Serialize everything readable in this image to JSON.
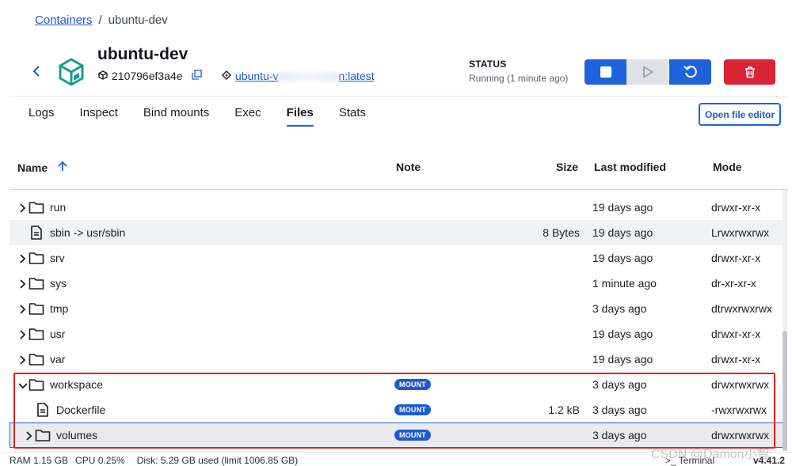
{
  "breadcrumb": {
    "root": "Containers",
    "separator": "/",
    "current": "ubuntu-dev"
  },
  "container": {
    "name": "ubuntu-dev",
    "id": "210796ef3a4e",
    "image_prefix": "ubuntu-v",
    "image_suffix": "n:latest"
  },
  "status": {
    "label": "STATUS",
    "value": "Running (1 minute ago)"
  },
  "colors": {
    "accent": "#1e63db",
    "danger": "#d92535",
    "container_icon": "#1b9b8a",
    "highlight": "#e02020"
  },
  "tabs": [
    {
      "label": "Logs"
    },
    {
      "label": "Inspect"
    },
    {
      "label": "Bind mounts"
    },
    {
      "label": "Exec"
    },
    {
      "label": "Files",
      "active": true
    },
    {
      "label": "Stats"
    }
  ],
  "open_editor": "Open file editor",
  "table": {
    "headers": {
      "name": "Name",
      "note": "Note",
      "size": "Size",
      "modified": "Last modified",
      "mode": "Mode"
    },
    "sort_icon": "arrow-up-icon",
    "rows": [
      {
        "type": "folder",
        "name": "run",
        "note": "",
        "size": "",
        "modified": "19 days ago",
        "mode": "drwxr-xr-x"
      },
      {
        "type": "file",
        "name": "sbin -> usr/sbin",
        "note": "",
        "size": "8 Bytes",
        "modified": "19 days ago",
        "mode": "Lrwxrwxrwx"
      },
      {
        "type": "folder",
        "name": "srv",
        "note": "",
        "size": "",
        "modified": "19 days ago",
        "mode": "drwxr-xr-x"
      },
      {
        "type": "folder",
        "name": "sys",
        "note": "",
        "size": "",
        "modified": "1 minute ago",
        "mode": "dr-xr-xr-x"
      },
      {
        "type": "folder",
        "name": "tmp",
        "note": "",
        "size": "",
        "modified": "3 days ago",
        "mode": "dtrwxrwxrwx"
      },
      {
        "type": "folder",
        "name": "usr",
        "note": "",
        "size": "",
        "modified": "19 days ago",
        "mode": "drwxr-xr-x"
      },
      {
        "type": "folder",
        "name": "var",
        "note": "",
        "size": "",
        "modified": "19 days ago",
        "mode": "drwxr-xr-x"
      },
      {
        "type": "folder",
        "name": "workspace",
        "note": "MOUNT",
        "size": "",
        "modified": "3 days ago",
        "mode": "drwxrwxrwx",
        "expanded": true
      },
      {
        "type": "file",
        "name": "Dockerfile",
        "note": "MOUNT",
        "size": "1.2 kB",
        "modified": "3 days ago",
        "mode": "-rwxrwxrwx",
        "indent": 1
      },
      {
        "type": "folder",
        "name": "volumes",
        "note": "MOUNT",
        "size": "",
        "modified": "3 days ago",
        "mode": "drwxrwxrwx",
        "indent": 1,
        "selected": true
      }
    ]
  },
  "footer": {
    "ram": "RAM 1.15 GB",
    "cpu": "CPU 0.25%",
    "disk": "Disk: 5.29 GB used (limit 1006.85 GB)",
    "terminal": ">_ Terminal",
    "version": "v4.41.2"
  },
  "watermark": "CSDN @Damon小智"
}
